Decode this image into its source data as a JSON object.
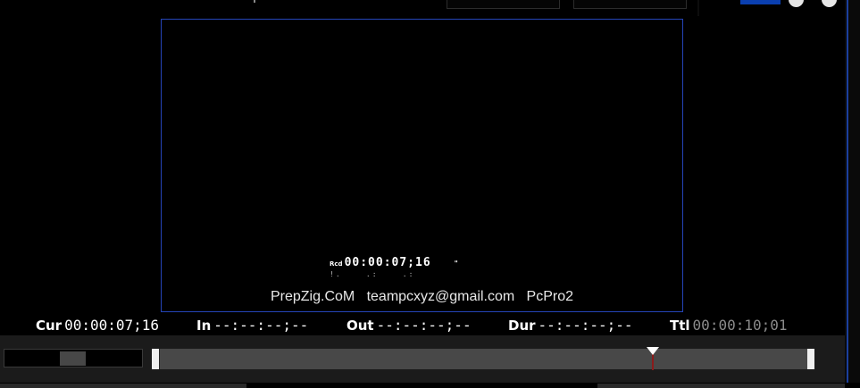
{
  "preview": {
    "overlay": {
      "rcd_label": "Rcd",
      "timecode": "00:00:07;16",
      "marker": "\"",
      "status_dots": "!.    .:    .:",
      "credit": "PrepZig.CoM   teampcxyz@gmail.com   PcPro2"
    }
  },
  "timecodes": {
    "cur": {
      "label": "Cur",
      "value": "00:00:07;16"
    },
    "in": {
      "label": "In",
      "value": "--:--:--;--"
    },
    "out": {
      "label": "Out",
      "value": "--:--:--;--"
    },
    "dur": {
      "label": "Dur",
      "value": "--:--:--;--"
    },
    "ttl": {
      "label": "Ttl",
      "value": "00:00:10;01"
    }
  },
  "timeline": {
    "current_timecode": "00:00:07;16",
    "total_timecode": "00:00:10;01",
    "playhead_fraction": 0.756
  },
  "colors": {
    "accent": "#0a3fb0",
    "preview_border": "#2444b8",
    "playhead_line": "#8a1b1b"
  }
}
